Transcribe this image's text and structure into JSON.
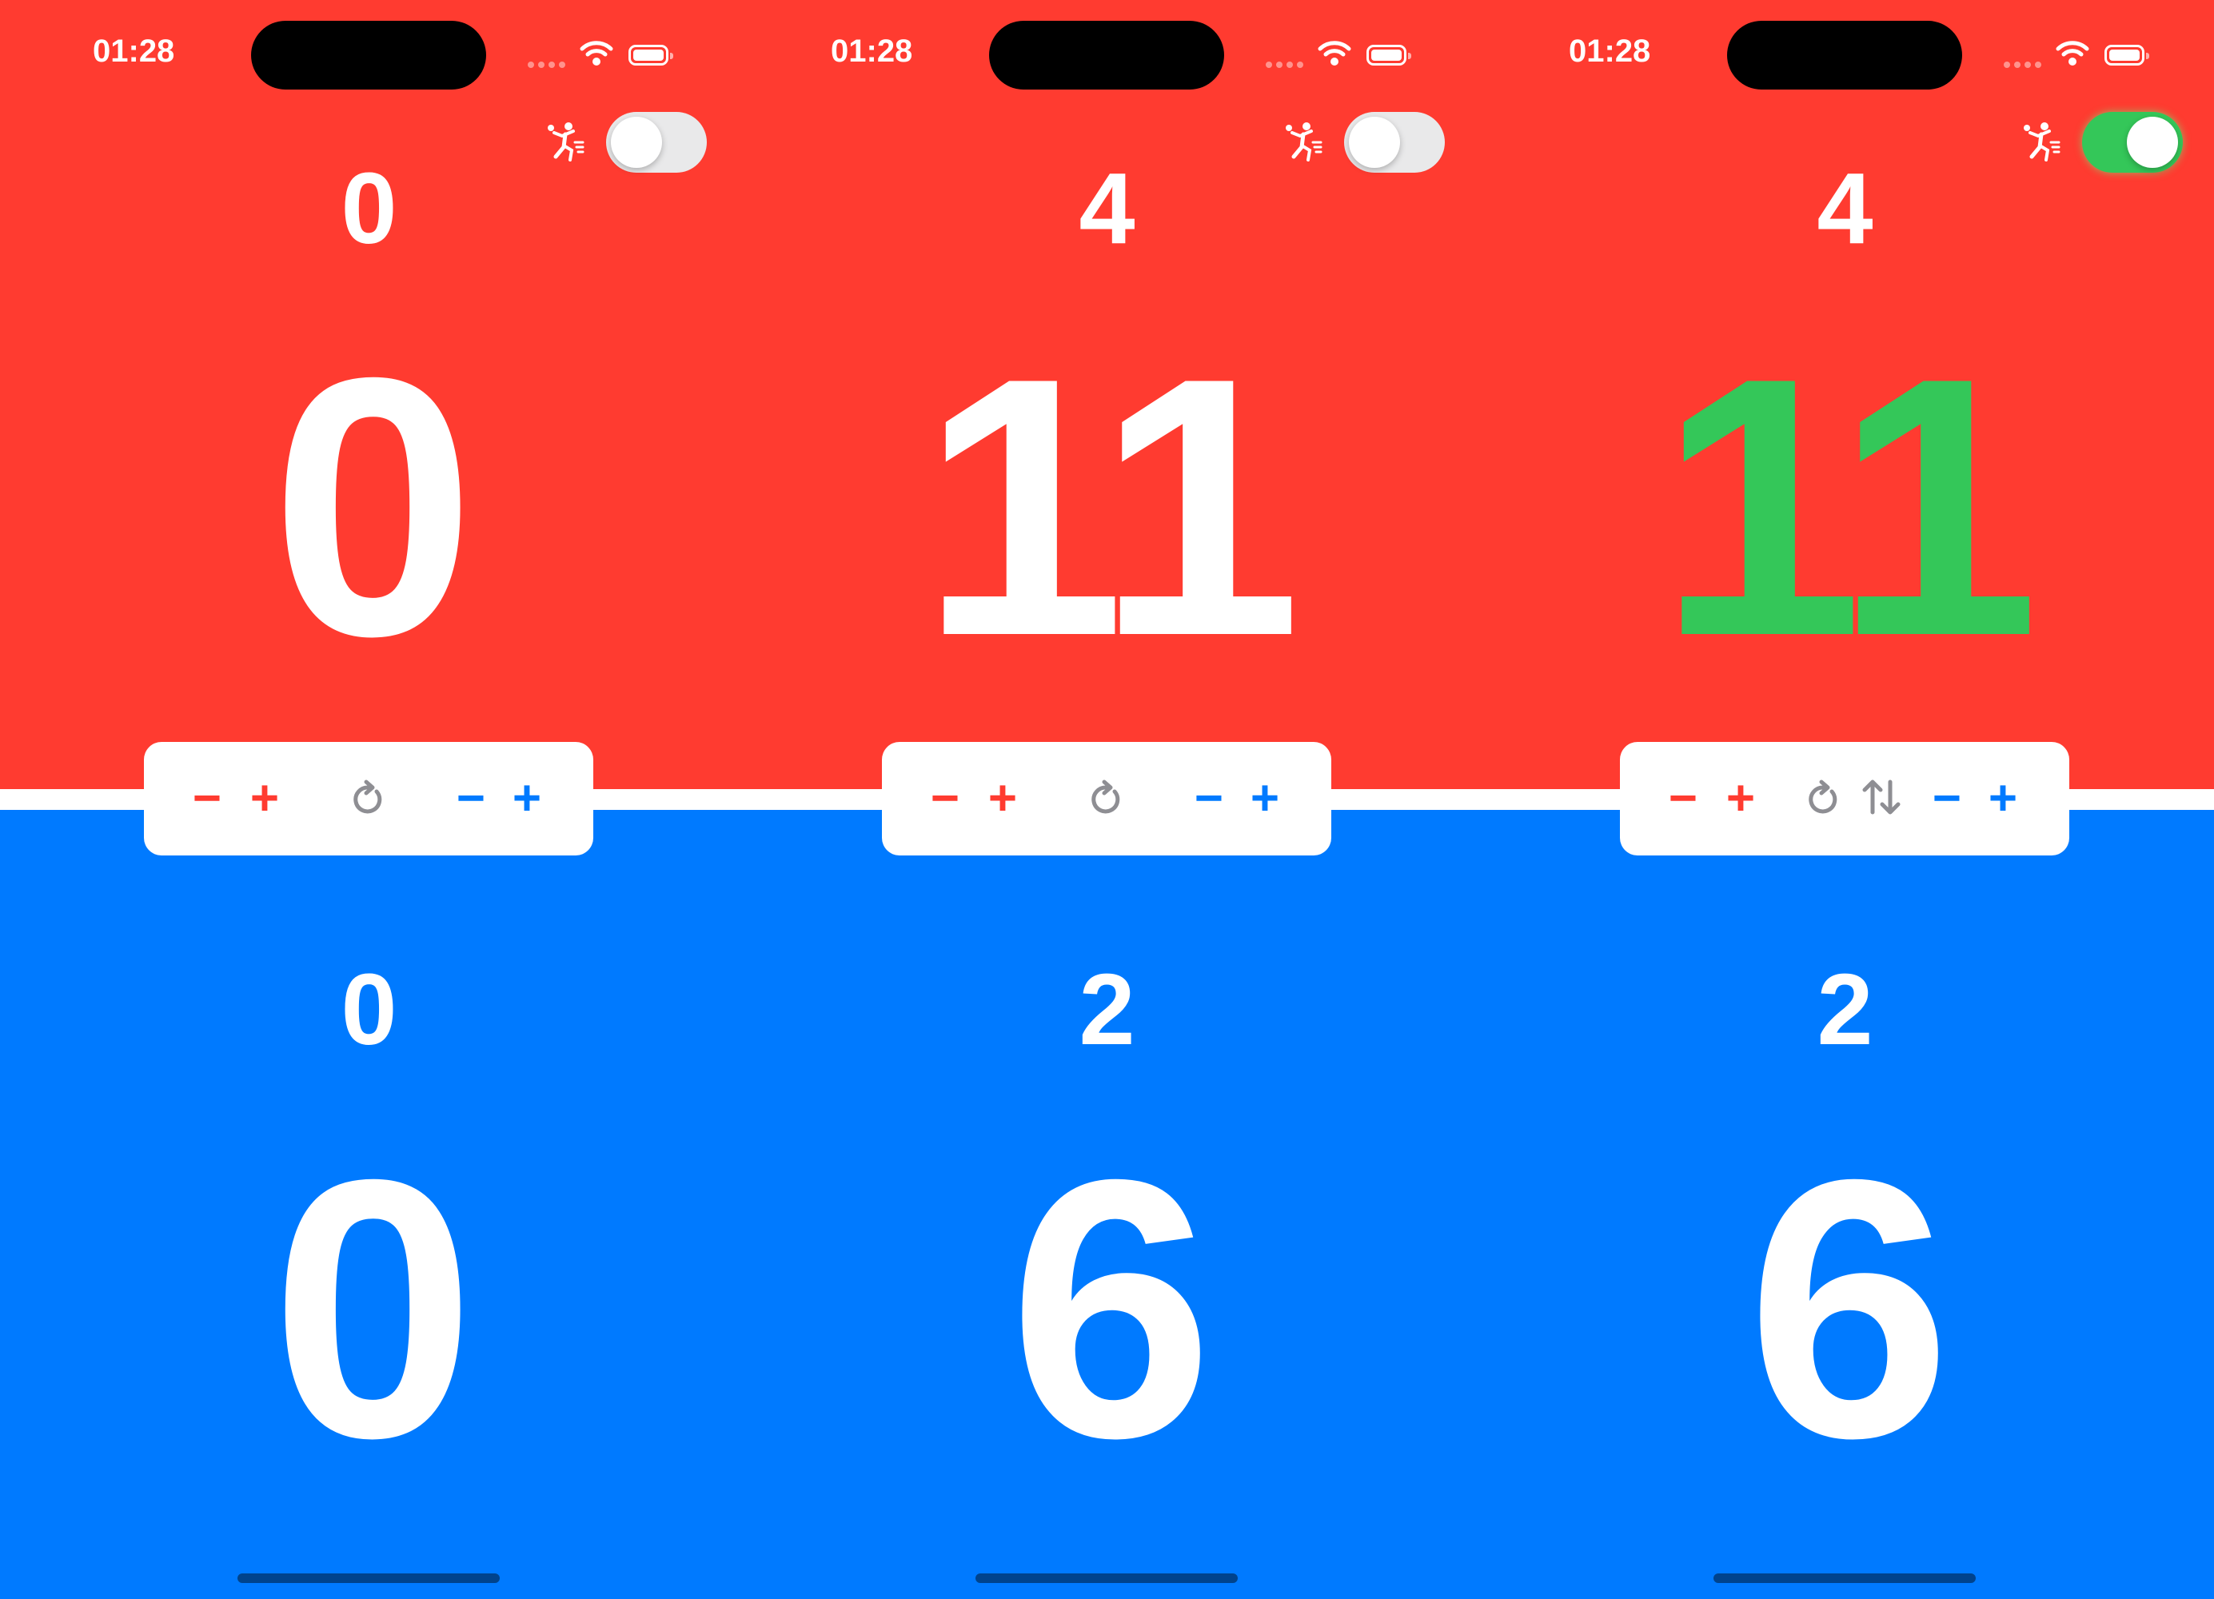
{
  "colors": {
    "team_top": "#FF3B30",
    "team_bottom": "#007AFF",
    "winning_score": "#34C759",
    "toggle_off": "#E9E9EA",
    "toggle_on": "#34C759"
  },
  "screens": [
    {
      "status": {
        "time": "01:28"
      },
      "serve_toggle": {
        "icon": "ping-pong-player-icon",
        "state": "off"
      },
      "top_team": {
        "games": "0",
        "points": "0"
      },
      "bottom_team": {
        "games": "0",
        "points": "0"
      },
      "controls": {
        "minus": "−",
        "plus": "+",
        "reset_icon": "reset-icon",
        "swap_visible": false
      }
    },
    {
      "status": {
        "time": "01:28"
      },
      "serve_toggle": {
        "icon": "ping-pong-player-icon",
        "state": "off"
      },
      "top_team": {
        "games": "4",
        "points": "11"
      },
      "bottom_team": {
        "games": "2",
        "points": "6"
      },
      "controls": {
        "minus": "−",
        "plus": "+",
        "reset_icon": "reset-icon",
        "swap_visible": false
      }
    },
    {
      "status": {
        "time": "01:28"
      },
      "serve_toggle": {
        "icon": "ping-pong-player-icon",
        "state": "on"
      },
      "top_team": {
        "games": "4",
        "points": "11",
        "winning": true
      },
      "bottom_team": {
        "games": "2",
        "points": "6"
      },
      "controls": {
        "minus": "−",
        "plus": "+",
        "reset_icon": "reset-icon",
        "swap_visible": true,
        "swap_icon": "swap-sides-icon"
      }
    }
  ]
}
